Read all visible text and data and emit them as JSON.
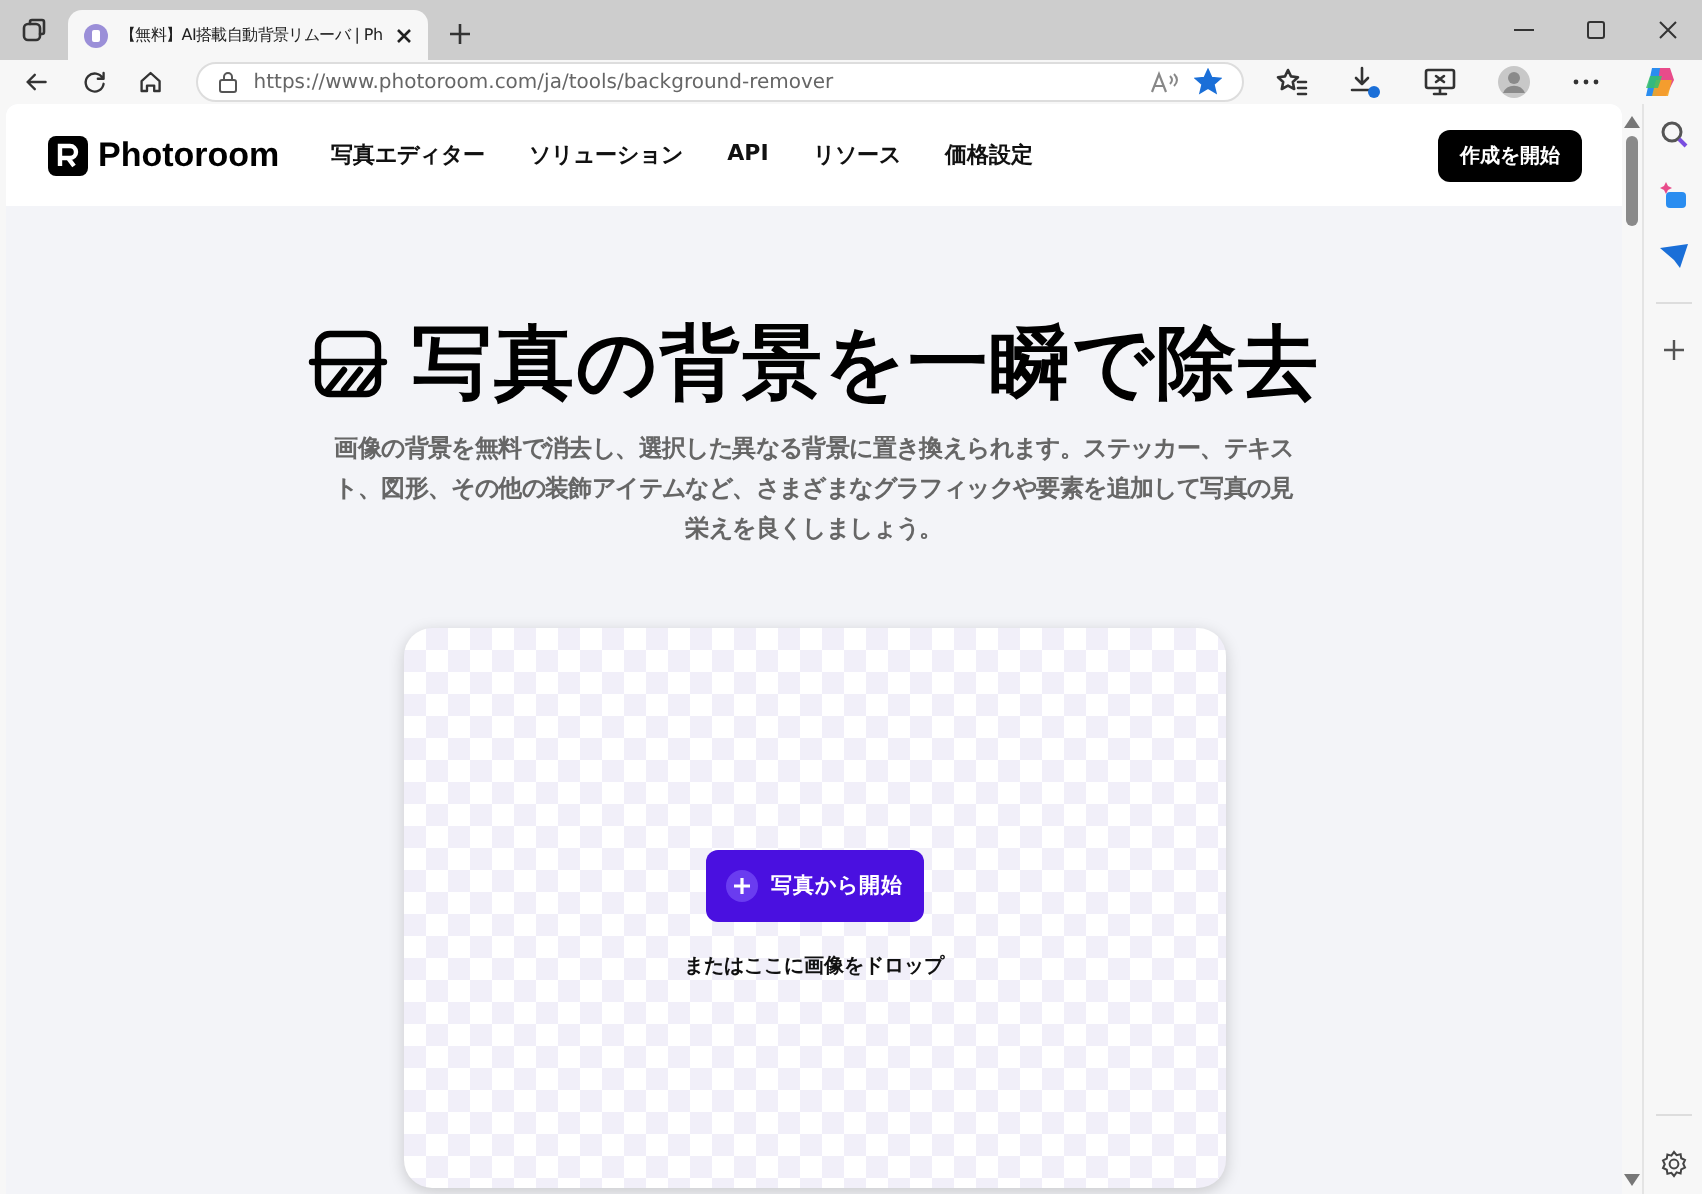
{
  "browser": {
    "tab": {
      "title": "【無料】AI搭載自動背景リムーバ | Ph",
      "selected": true
    },
    "address": "https://www.photoroom.com/ja/tools/background-remover",
    "favorite": true
  },
  "site": {
    "logo": "Photoroom",
    "nav": [
      "写真エディター",
      "ソリューション",
      "API",
      "リソース",
      "価格設定"
    ],
    "cta": "作成を開始"
  },
  "hero": {
    "title": "写真の背景を一瞬で除去",
    "description": "画像の背景を無料で消去し、選択した異なる背景に置き換えられます。ステッカー、テキスト、図形、その他の装飾アイテムなど、さまざまなグラフィックや要素を追加して写真の見栄えを良くしましょう。"
  },
  "upload": {
    "button": "写真から開始",
    "hint": "またはここに画像をドロップ"
  }
}
